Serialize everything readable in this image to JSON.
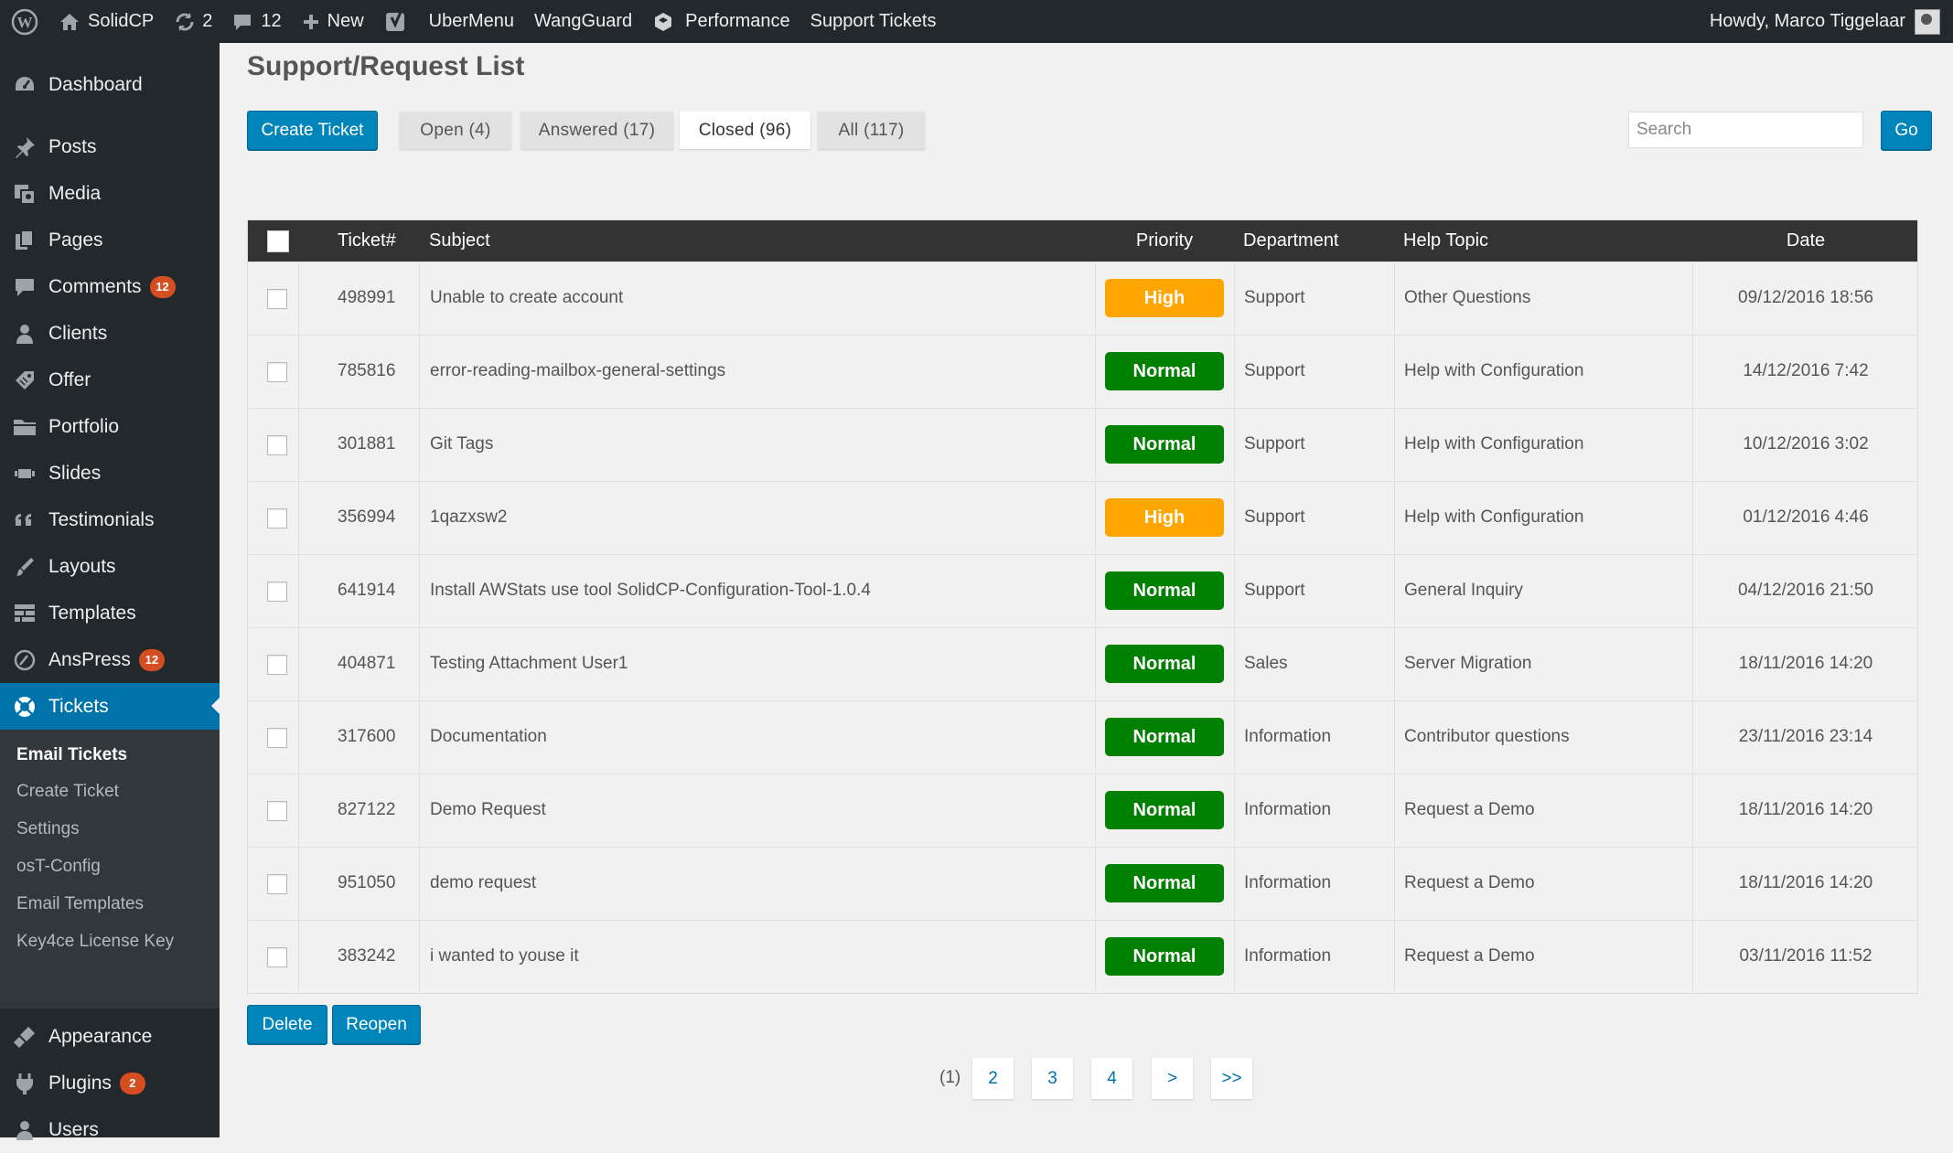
{
  "admin_bar": {
    "site_name": "SolidCP",
    "updates_count": "2",
    "comments_count": "12",
    "new_label": "New",
    "ubermenu_label": "UberMenu",
    "wangguard_label": "WangGuard",
    "performance_label": "Performance",
    "support_tickets_label": "Support Tickets",
    "howdy": "Howdy, Marco Tiggelaar"
  },
  "sidebar": {
    "items": [
      {
        "label": "Dashboard",
        "icon": "dashboard-icon"
      },
      {
        "label": "Posts",
        "icon": "pin-icon"
      },
      {
        "label": "Media",
        "icon": "media-icon"
      },
      {
        "label": "Pages",
        "icon": "pages-icon"
      },
      {
        "label": "Comments",
        "icon": "comment-icon",
        "badge": "12"
      },
      {
        "label": "Clients",
        "icon": "user-icon"
      },
      {
        "label": "Offer",
        "icon": "tag-icon"
      },
      {
        "label": "Portfolio",
        "icon": "folder-icon"
      },
      {
        "label": "Slides",
        "icon": "slides-icon"
      },
      {
        "label": "Testimonials",
        "icon": "quote-icon"
      },
      {
        "label": "Layouts",
        "icon": "brush-icon"
      },
      {
        "label": "Templates",
        "icon": "templates-icon"
      },
      {
        "label": "AnsPress",
        "icon": "anspress-icon",
        "badge": "12"
      },
      {
        "label": "Tickets",
        "icon": "lifebuoy-icon"
      },
      {
        "label": "Appearance",
        "icon": "appearance-icon"
      },
      {
        "label": "Plugins",
        "icon": "plugin-icon",
        "badge": "2"
      },
      {
        "label": "Users",
        "icon": "users-icon"
      }
    ],
    "submenu": [
      "Email Tickets",
      "Create Ticket",
      "Settings",
      "osT-Config",
      "Email Templates",
      "Key4ce License Key"
    ]
  },
  "page_title": "Support/Request List",
  "create_ticket_label": "Create Ticket",
  "tabs": [
    "Open (4)",
    "Answered (17)",
    "Closed (96)",
    "All (117)"
  ],
  "active_tab": "Closed (96)",
  "search": {
    "placeholder": "Search",
    "value": "",
    "go_label": "Go"
  },
  "table": {
    "headers": {
      "ticket": "Ticket#",
      "subject": "Subject",
      "priority": "Priority",
      "department": "Department",
      "help_topic": "Help Topic",
      "date": "Date"
    },
    "rows": [
      {
        "id": "498991",
        "subject": "Unable to create account",
        "priority": "High",
        "department": "Support",
        "topic": "Other Questions",
        "date": "09/12/2016 18:56"
      },
      {
        "id": "785816",
        "subject": "error-reading-mailbox-general-settings",
        "priority": "Normal",
        "department": "Support",
        "topic": "Help with Configuration",
        "date": "14/12/2016 7:42"
      },
      {
        "id": "301881",
        "subject": "Git Tags",
        "priority": "Normal",
        "department": "Support",
        "topic": "Help with Configuration",
        "date": "10/12/2016 3:02"
      },
      {
        "id": "356994",
        "subject": "1qazxsw2",
        "priority": "High",
        "department": "Support",
        "topic": "Help with Configuration",
        "date": "01/12/2016 4:46"
      },
      {
        "id": "641914",
        "subject": "Install AWStats use tool SolidCP-Configuration-Tool-1.0.4",
        "priority": "Normal",
        "department": "Support",
        "topic": "General Inquiry",
        "date": "04/12/2016 21:50"
      },
      {
        "id": "404871",
        "subject": "Testing Attachment User1",
        "priority": "Normal",
        "department": "Sales",
        "topic": "Server Migration",
        "date": "18/11/2016 14:20"
      },
      {
        "id": "317600",
        "subject": "Documentation",
        "priority": "Normal",
        "department": "Information",
        "topic": "Contributor questions",
        "date": "23/11/2016 23:14"
      },
      {
        "id": "827122",
        "subject": "Demo Request",
        "priority": "Normal",
        "department": "Information",
        "topic": "Request a Demo",
        "date": "18/11/2016 14:20"
      },
      {
        "id": "951050",
        "subject": "demo request",
        "priority": "Normal",
        "department": "Information",
        "topic": "Request a Demo",
        "date": "18/11/2016 14:20"
      },
      {
        "id": "383242",
        "subject": "i wanted to youse it",
        "priority": "Normal",
        "department": "Information",
        "topic": "Request a Demo",
        "date": "03/11/2016 11:52"
      }
    ]
  },
  "actions": {
    "delete_label": "Delete",
    "reopen_label": "Reopen"
  },
  "pagination": {
    "current": "(1)",
    "pages": [
      "2",
      "3",
      "4",
      ">",
      ">>"
    ]
  },
  "colors": {
    "accent": "#0085ba",
    "admin_bar": "#23282d",
    "priority_high": "#ffa500",
    "priority_normal": "#008000",
    "table_header": "#333333"
  }
}
